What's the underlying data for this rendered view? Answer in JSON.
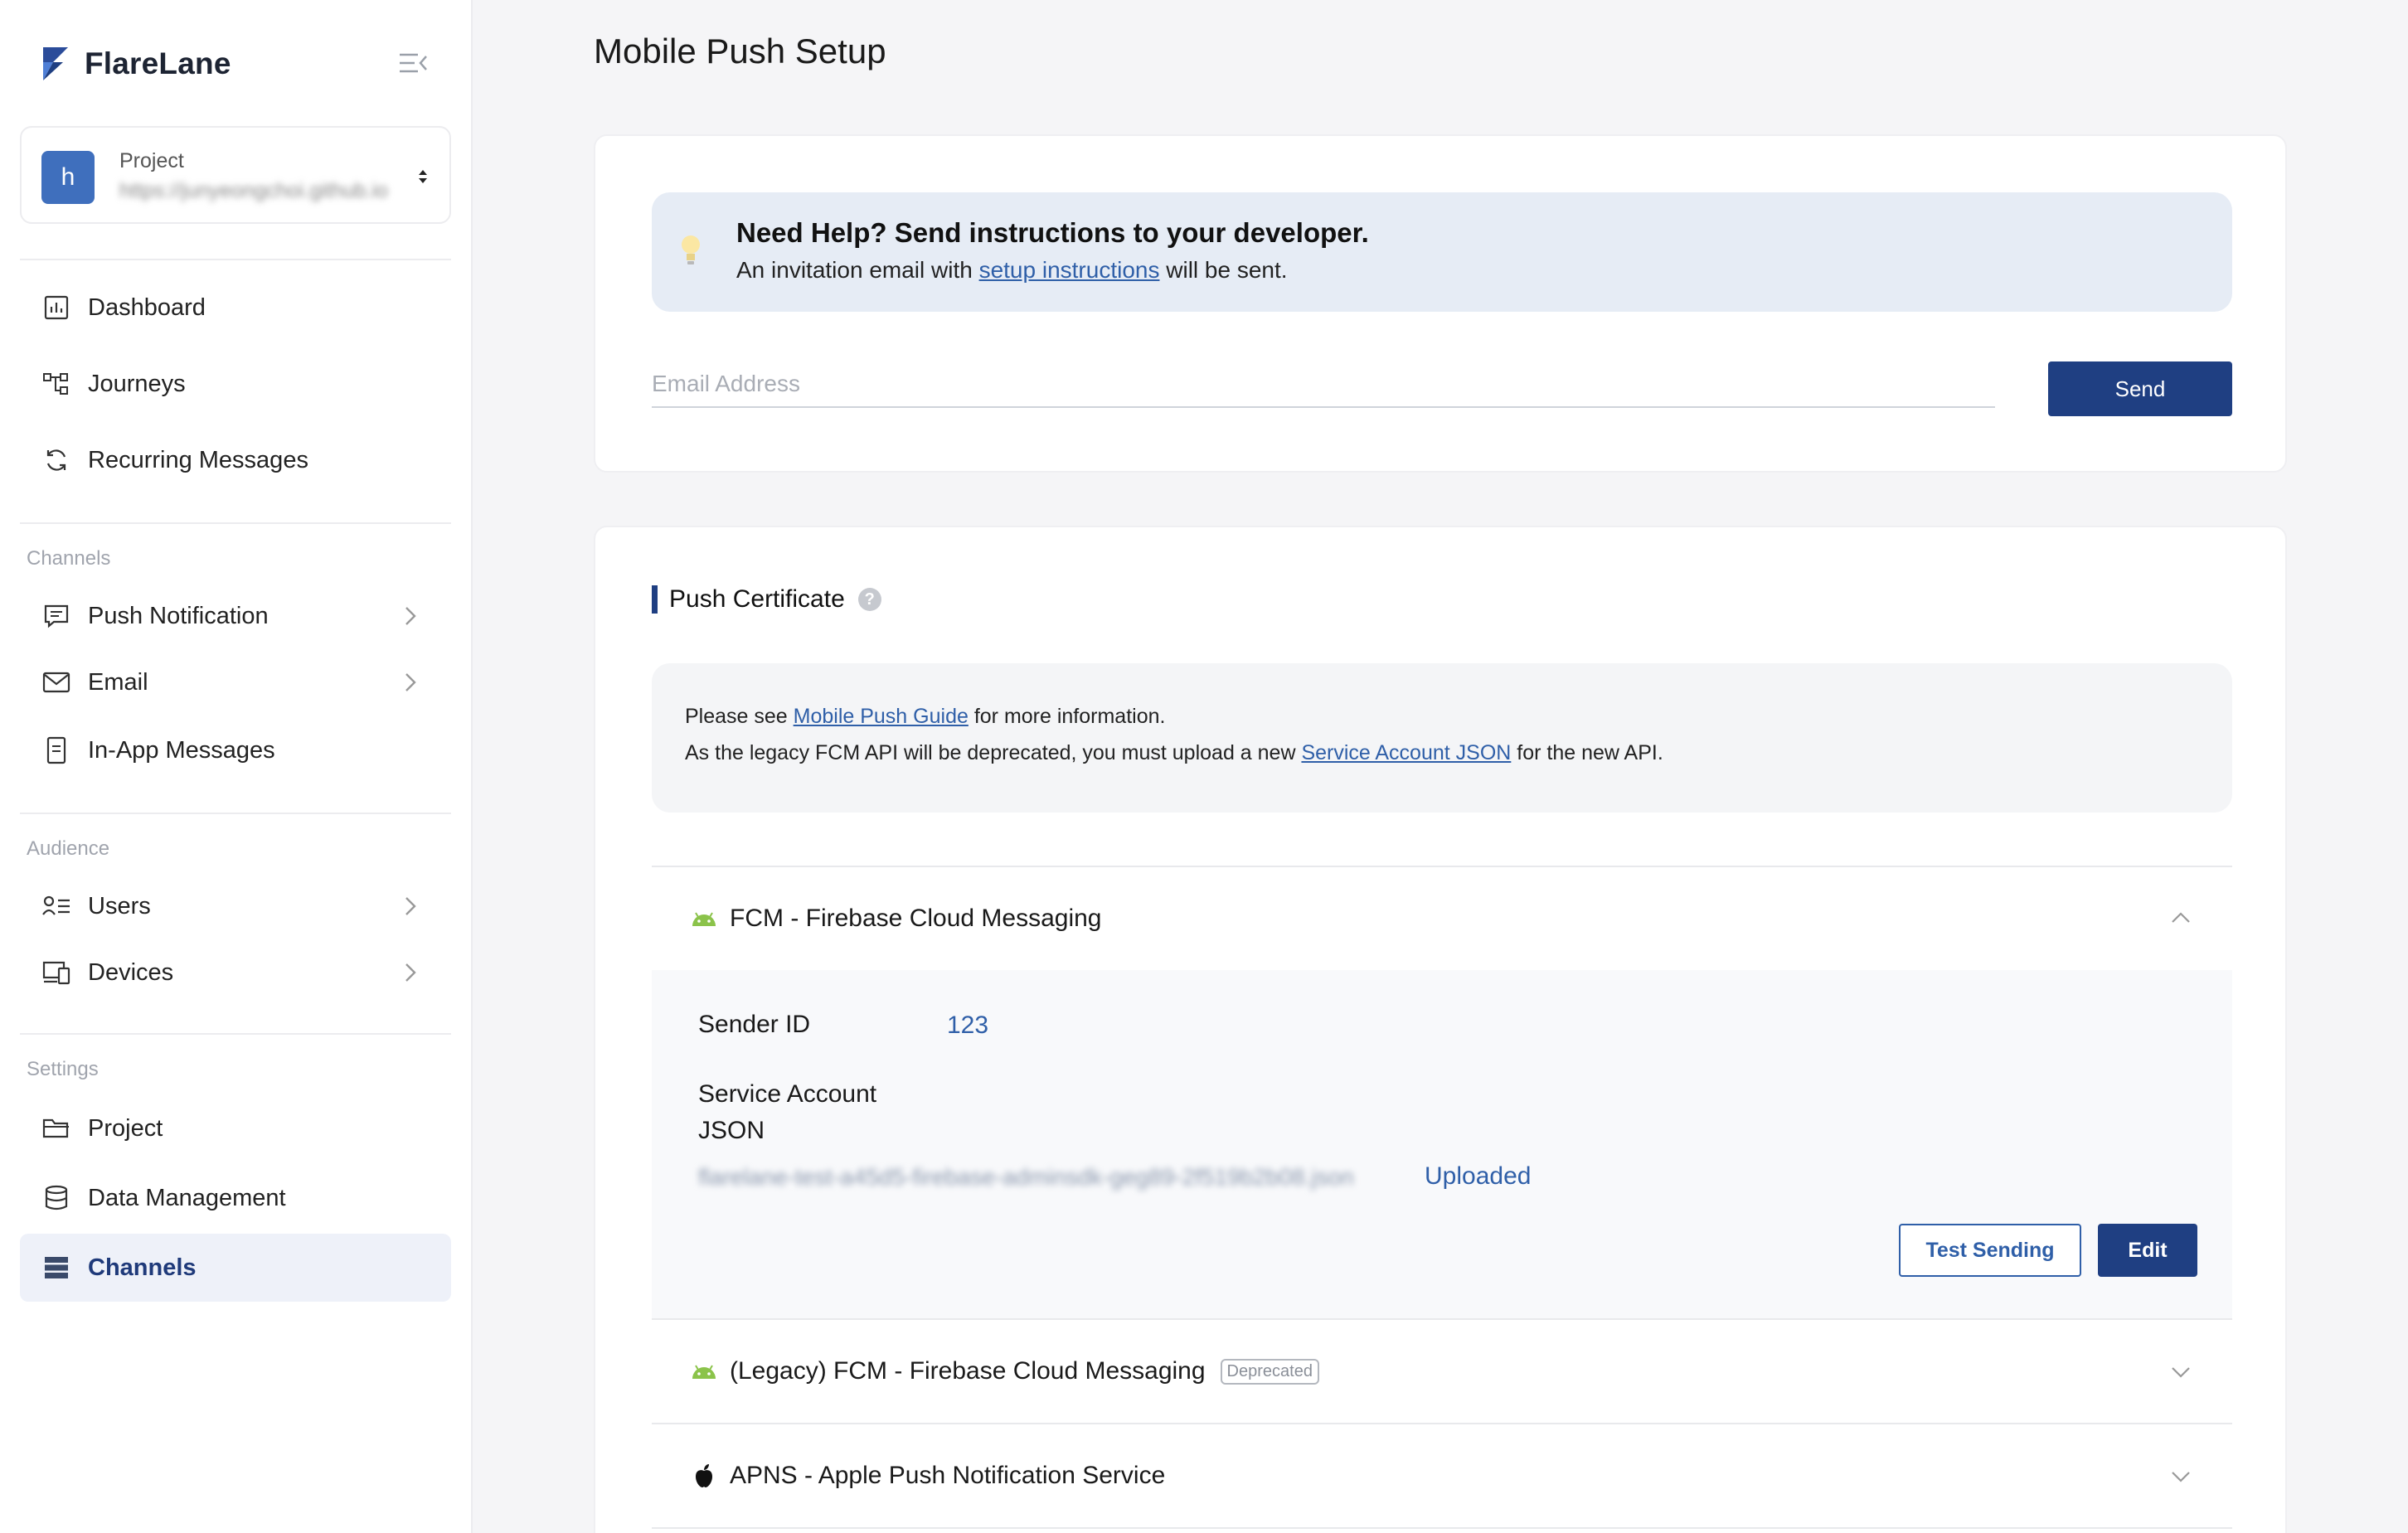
{
  "brand": {
    "name": "FlareLane",
    "accent": "#1f3f82"
  },
  "project": {
    "label": "Project",
    "avatar_letter": "h",
    "url": "https://junyeongchoi.github.io"
  },
  "nav": {
    "main": [
      {
        "label": "Dashboard",
        "icon": "bar-chart-icon"
      },
      {
        "label": "Journeys",
        "icon": "flow-icon"
      },
      {
        "label": "Recurring Messages",
        "icon": "refresh-icon"
      }
    ],
    "channels_label": "Channels",
    "channels": [
      {
        "label": "Push Notification",
        "icon": "message-icon"
      },
      {
        "label": "Email",
        "icon": "mail-icon"
      },
      {
        "label": "In-App Messages",
        "icon": "phone-doc-icon"
      }
    ],
    "audience_label": "Audience",
    "audience": [
      {
        "label": "Users",
        "icon": "users-list-icon"
      },
      {
        "label": "Devices",
        "icon": "devices-icon"
      }
    ],
    "settings_label": "Settings",
    "settings": [
      {
        "label": "Project",
        "icon": "folder-icon"
      },
      {
        "label": "Data Management",
        "icon": "database-icon"
      },
      {
        "label": "Channels",
        "icon": "server-icon"
      }
    ]
  },
  "page": {
    "title": "Mobile Push Setup"
  },
  "help": {
    "title": "Need Help? Send instructions to your developer.",
    "sub_before": "An invitation email with ",
    "sub_link": "setup instructions",
    "sub_after": " will be sent.",
    "email_placeholder": "Email Address",
    "send_label": "Send"
  },
  "cert": {
    "title": "Push Certificate",
    "help_glyph": "?",
    "info1_before": "Please see ",
    "info1_link": "Mobile Push Guide",
    "info1_after": " for more information.",
    "info2_before": "As the legacy FCM API will be deprecated, you must upload a new ",
    "info2_link": "Service Account JSON",
    "info2_after": " for the new API."
  },
  "fcm": {
    "title": "FCM - Firebase Cloud Messaging",
    "sender_label": "Sender ID",
    "sender_value": "123",
    "json_label_1": "Service Account",
    "json_label_2": "JSON",
    "file_name": "flarelane-test-a45d5-firebase-adminsdk-geg89-2f519b2b08.json",
    "uploaded_label": "Uploaded",
    "test_label": "Test Sending",
    "edit_label": "Edit"
  },
  "legacy": {
    "title": "(Legacy) FCM - Firebase Cloud Messaging",
    "badge": "Deprecated"
  },
  "apns": {
    "title": "APNS - Apple Push Notification Service"
  }
}
